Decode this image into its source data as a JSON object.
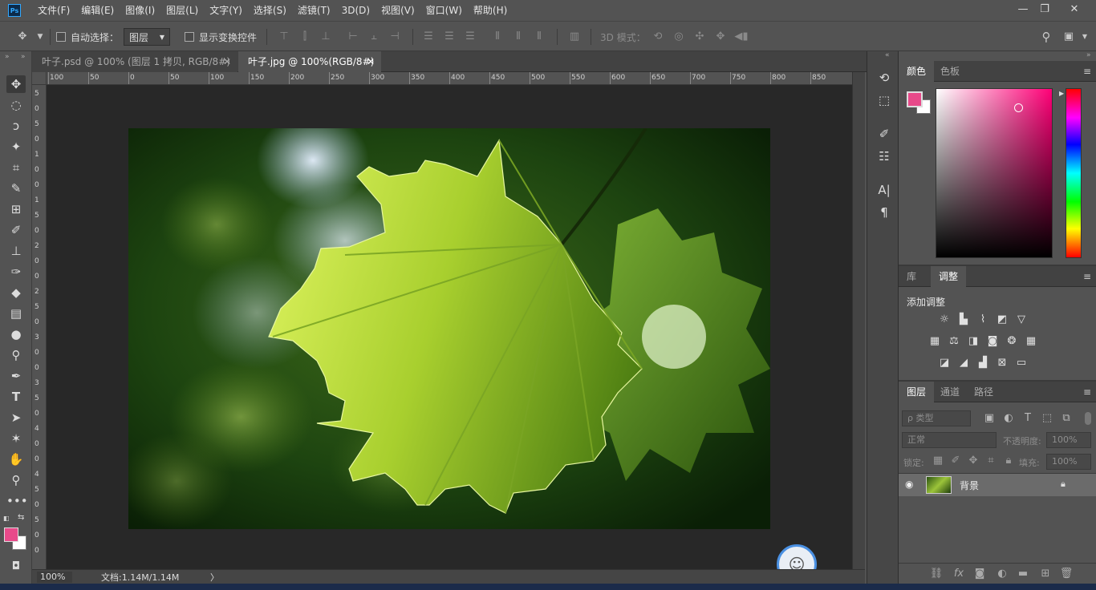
{
  "app": {
    "logo": "Ps"
  },
  "menu": [
    "文件(F)",
    "编辑(E)",
    "图像(I)",
    "图层(L)",
    "文字(Y)",
    "选择(S)",
    "滤镜(T)",
    "3D(D)",
    "视图(V)",
    "窗口(W)",
    "帮助(H)"
  ],
  "window_controls": {
    "minimize": "—",
    "restore": "❐",
    "close": "✕"
  },
  "options": {
    "auto_select_label": "自动选择：",
    "auto_select_value": "图层",
    "show_transform_label": "显示变换控件",
    "mode_3d_label": "3D 模式："
  },
  "tabs": [
    {
      "label": "叶子.psd @ 100% (图层 1 拷贝, RGB/8#)",
      "close": "✕",
      "active": false
    },
    {
      "label": "叶子.jpg @ 100%(RGB/8#)",
      "close": "✕",
      "active": true
    }
  ],
  "ruler_top": [
    "100",
    "50",
    "0",
    "50",
    "100",
    "150",
    "200",
    "250",
    "300",
    "350",
    "400",
    "450",
    "500",
    "550",
    "600",
    "650",
    "700",
    "750",
    "800",
    "850"
  ],
  "ruler_left": [
    "5",
    "0",
    "5",
    "0",
    "1",
    "0",
    "0",
    "1",
    "5",
    "0",
    "2",
    "0",
    "0",
    "2",
    "5",
    "0",
    "3",
    "0",
    "0",
    "3",
    "5",
    "0",
    "4",
    "0",
    "0",
    "4",
    "5",
    "0",
    "5",
    "0",
    "0"
  ],
  "status": {
    "zoom": "100%",
    "doc": "文档:1.14M/1.14M",
    "arrow": "〉"
  },
  "colors": {
    "foreground": "#e84a8a",
    "background": "#ffffff",
    "picker_hue": "#ff0077"
  },
  "color_panel": {
    "tabs": [
      "颜色",
      "色板"
    ]
  },
  "adjust_panel": {
    "tabs": [
      "库",
      "调整"
    ],
    "title": "添加调整"
  },
  "layers_panel": {
    "tabs": [
      "图层",
      "通道",
      "路径"
    ],
    "filter_placeholder": "ρ 类型",
    "blend_mode": "正常",
    "opacity_label": "不透明度:",
    "opacity_value": "100%",
    "lock_label": "锁定:",
    "fill_label": "填充:",
    "fill_value": "100%",
    "layers": [
      {
        "name": "背景",
        "visible": true,
        "locked": true
      }
    ]
  }
}
